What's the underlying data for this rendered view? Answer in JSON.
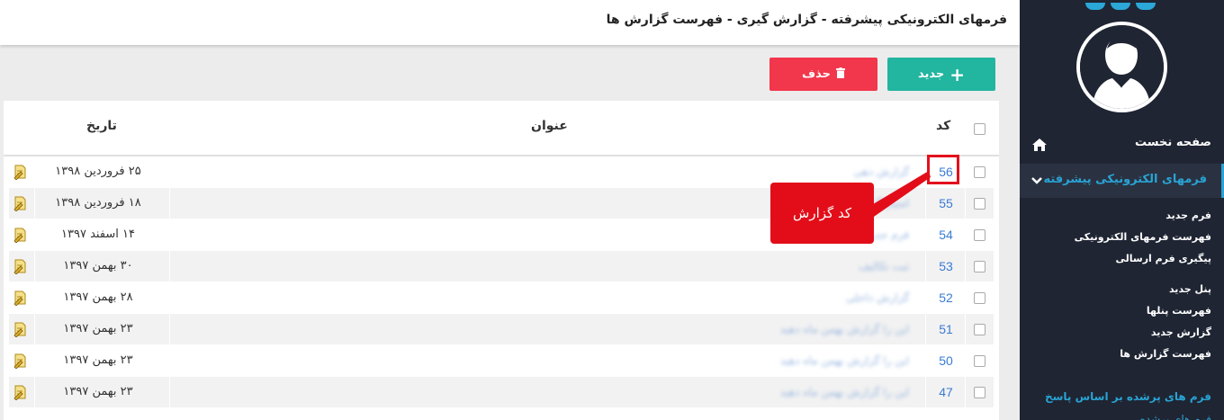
{
  "header": {
    "title": "فرمهای الکترونیکی پیشرفته - گزارش گیری - فهرست گزارش ها"
  },
  "toolbar": {
    "new_label": "جدید",
    "delete_label": "حذف"
  },
  "table": {
    "columns": {
      "code": "کد",
      "title": "عنوان",
      "date": "تاریخ"
    },
    "rows": [
      {
        "code": "56",
        "title": "گزارش دهی",
        "date": "۲۵ فروردین ۱۳۹۸"
      },
      {
        "code": "55",
        "title": "امتیاز گزارش",
        "date": "۱۸ فروردین ۱۳۹۸"
      },
      {
        "code": "54",
        "title": "فرم جدید",
        "date": "۱۴ اسفند ۱۳۹۷"
      },
      {
        "code": "53",
        "title": "ثبت تکالیف",
        "date": "۳۰ بهمن ۱۳۹۷"
      },
      {
        "code": "52",
        "title": "گزارش داخلی",
        "date": "۲۸ بهمن ۱۳۹۷"
      },
      {
        "code": "51",
        "title": "این را گزارش بهمن ماه دهید",
        "date": "۲۳ بهمن ۱۳۹۷"
      },
      {
        "code": "50",
        "title": "این را گزارش بهمن ماه دهید",
        "date": "۲۳ بهمن ۱۳۹۷"
      },
      {
        "code": "47",
        "title": "این را گزارش بهمن ماه دهید",
        "date": "۲۳ بهمن ۱۳۹۷"
      }
    ]
  },
  "annotation": {
    "callout_text": "کد گزارش"
  },
  "sidebar": {
    "home": "صفحه نخست",
    "group": "فرمهای الکترونیکی پیشرفته",
    "sub1": [
      "فرم جدید",
      "فهرست فرمهای الکترونیکی",
      "پیگیری فرم ارسالی"
    ],
    "sub2": [
      "پنل جدید",
      "فهرست پنلها",
      "گزارش جدید",
      "فهرست گزارش ها"
    ],
    "bottom": "فرم های پرشده بر اساس پاسخ",
    "bottom2": "فرم های پرشده"
  },
  "colors": {
    "accent": "#29a3d4",
    "new_button": "#22b5a0",
    "delete_button": "#f2364b",
    "annotation": "#e30d19",
    "sidebar_bg": "#1f2533"
  }
}
